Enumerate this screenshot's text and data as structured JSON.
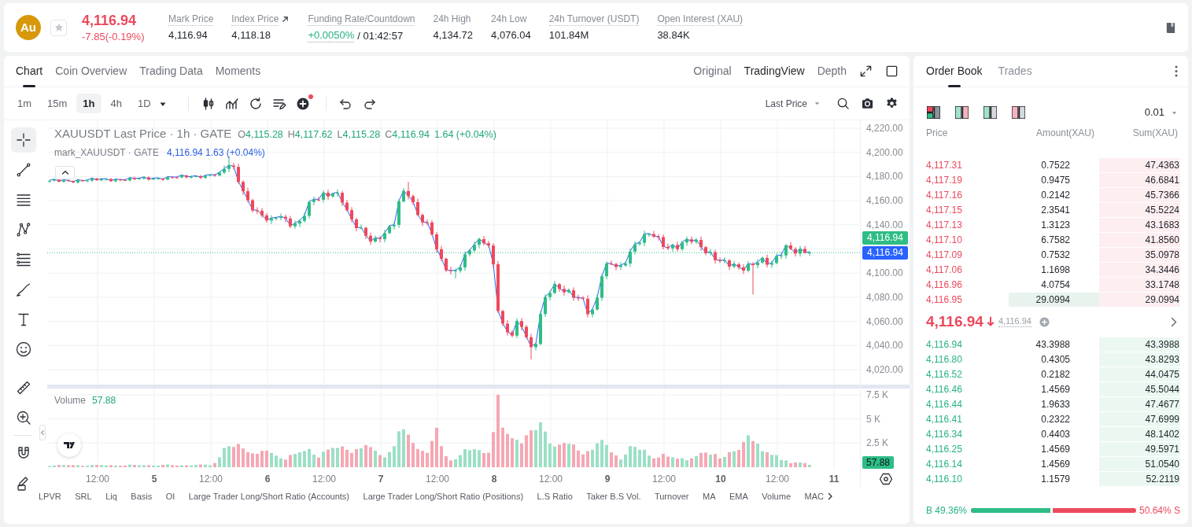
{
  "header": {
    "coin_logo": "Au",
    "starred": false,
    "last_price": "4,116.94",
    "change": "-7.85(-0.19%)",
    "stats": [
      {
        "kind": "plain",
        "label": "Mark Price",
        "value": "4,116.94",
        "underlined": true,
        "external": false
      },
      {
        "kind": "plain",
        "label": "Index Price",
        "value": "4,118.18",
        "underlined": true,
        "external": true
      },
      {
        "kind": "funding",
        "label": "Funding Rate/Countdown",
        "value": "+0.0050%",
        "countdown": "/ 01:42:57",
        "underlined": true,
        "external": false
      },
      {
        "kind": "plain",
        "label": "24h High",
        "value": "4,134.72",
        "underlined": false,
        "external": false
      },
      {
        "kind": "plain",
        "label": "24h Low",
        "value": "4,076.04",
        "underlined": false,
        "external": false
      },
      {
        "kind": "plain",
        "label": "24h Turnover (USDT)",
        "value": "101.84M",
        "underlined": true,
        "external": false
      },
      {
        "kind": "plain",
        "label": "Open Interest (XAU)",
        "value": "38.84K",
        "underlined": true,
        "external": false
      }
    ]
  },
  "chart": {
    "tabs": [
      {
        "label": "Chart",
        "selected": true
      },
      {
        "label": "Coin Overview",
        "selected": false
      },
      {
        "label": "Trading Data",
        "selected": false
      },
      {
        "label": "Moments",
        "selected": false
      }
    ],
    "view_modes": [
      {
        "label": "Original",
        "selected": false
      },
      {
        "label": "TradingView",
        "selected": true
      },
      {
        "label": "Depth",
        "selected": false
      }
    ],
    "intervals": [
      {
        "label": "1m",
        "selected": false
      },
      {
        "label": "15m",
        "selected": false
      },
      {
        "label": "1h",
        "selected": true
      },
      {
        "label": "4h",
        "selected": false
      },
      {
        "label": "1D",
        "selected": false
      }
    ],
    "price_source": "Last Price",
    "drawing_tools": [
      {
        "selected": true
      },
      {
        "selected": false
      },
      {
        "selected": false
      },
      {
        "selected": false
      },
      {
        "selected": false
      },
      {
        "selected": false
      },
      {
        "selected": false
      },
      {
        "selected": false
      },
      {
        "selected": false
      },
      {
        "selected": false
      },
      {
        "selected": false
      },
      {
        "selected": false
      }
    ],
    "legend": {
      "title": "XAUUSDT Last Price · 1h · GATE",
      "ohlc": [
        {
          "key": "O",
          "value": "4,115.28"
        },
        {
          "key": "H",
          "value": "4,117.62"
        },
        {
          "key": "L",
          "value": "4,115.28"
        },
        {
          "key": "C",
          "value": "4,116.94"
        }
      ],
      "change": "1.64 (+0.04%)"
    },
    "mark_legend": {
      "title": "mark_XAUUSDT · GATE",
      "values": "4,116.94 1.63 (+0.04%)"
    },
    "price_axis": [
      "4,220.00",
      "4,200.00",
      "4,180.00",
      "4,160.00",
      "4,140.00",
      "4,100.00",
      "4,080.00",
      "4,060.00",
      "4,040.00",
      "4,020.00"
    ],
    "price_tags": [
      {
        "text": "4,116.94",
        "color": "#2ebd85"
      },
      {
        "text": "4,116.94",
        "color": "#2962ff"
      }
    ],
    "volume": {
      "label": "Volume",
      "value": "57.88",
      "axis": [
        "7.5 K",
        "5 K",
        "2.5 K"
      ],
      "tag": "57.88"
    },
    "time_axis": [
      {
        "label": "12:00",
        "kind": "time"
      },
      {
        "label": "5",
        "kind": "day"
      },
      {
        "label": "12:00",
        "kind": "time"
      },
      {
        "label": "6",
        "kind": "day"
      },
      {
        "label": "12:00",
        "kind": "time"
      },
      {
        "label": "7",
        "kind": "day"
      },
      {
        "label": "12:00",
        "kind": "time"
      },
      {
        "label": "8",
        "kind": "day"
      },
      {
        "label": "12:00",
        "kind": "time"
      },
      {
        "label": "9",
        "kind": "day"
      },
      {
        "label": "12:00",
        "kind": "time"
      },
      {
        "label": "10",
        "kind": "day"
      },
      {
        "label": "12:00",
        "kind": "time"
      },
      {
        "label": "11",
        "kind": "day"
      }
    ],
    "indicators": [
      "LPVR",
      "SRL",
      "Liq",
      "Basis",
      "OI",
      "Large Trader Long/Short Ratio (Accounts)",
      "Large Trader Long/Short Ratio (Positions)",
      "L.S Ratio",
      "Taker B.S Vol.",
      "Turnover",
      "MA",
      "EMA",
      "Volume",
      "MAC"
    ]
  },
  "order_book": {
    "tabs": [
      {
        "label": "Order Book",
        "selected": true
      },
      {
        "label": "Trades",
        "selected": false
      }
    ],
    "layouts": [
      {
        "selected": true
      },
      {
        "selected": false
      },
      {
        "selected": false
      },
      {
        "selected": false
      }
    ],
    "precision": "0.01",
    "columns": [
      "Price",
      "Amount(XAU)",
      "Sum(XAU)"
    ],
    "asks": [
      {
        "price": "4,117.31",
        "amount": "0.7522",
        "sum": "47.4363",
        "highlighted": false
      },
      {
        "price": "4,117.19",
        "amount": "0.9475",
        "sum": "46.6841",
        "highlighted": false
      },
      {
        "price": "4,117.16",
        "amount": "0.2142",
        "sum": "45.7366",
        "highlighted": false
      },
      {
        "price": "4,117.15",
        "amount": "2.3541",
        "sum": "45.5224",
        "highlighted": false
      },
      {
        "price": "4,117.13",
        "amount": "1.3123",
        "sum": "43.1683",
        "highlighted": false
      },
      {
        "price": "4,117.10",
        "amount": "6.7582",
        "sum": "41.8560",
        "highlighted": false
      },
      {
        "price": "4,117.09",
        "amount": "0.7532",
        "sum": "35.0978",
        "highlighted": false
      },
      {
        "price": "4,117.06",
        "amount": "1.1698",
        "sum": "34.3446",
        "highlighted": false
      },
      {
        "price": "4,116.96",
        "amount": "4.0754",
        "sum": "33.1748",
        "highlighted": false
      },
      {
        "price": "4,116.95",
        "amount": "29.0994",
        "sum": "29.0994",
        "highlighted": true
      }
    ],
    "last_price": "4,116.94",
    "price_falling": true,
    "mark_price": "4,116.94",
    "bids": [
      {
        "price": "4,116.94",
        "amount": "43.3988",
        "sum": "43.3988",
        "highlighted": false
      },
      {
        "price": "4,116.80",
        "amount": "0.4305",
        "sum": "43.8293",
        "highlighted": false
      },
      {
        "price": "4,116.52",
        "amount": "0.2182",
        "sum": "44.0475",
        "highlighted": false
      },
      {
        "price": "4,116.46",
        "amount": "1.4569",
        "sum": "45.5044",
        "highlighted": false
      },
      {
        "price": "4,116.44",
        "amount": "1.9633",
        "sum": "47.4677",
        "highlighted": false
      },
      {
        "price": "4,116.41",
        "amount": "0.2322",
        "sum": "47.6999",
        "highlighted": false
      },
      {
        "price": "4,116.34",
        "amount": "0.4403",
        "sum": "48.1402",
        "highlighted": false
      },
      {
        "price": "4,116.25",
        "amount": "1.4569",
        "sum": "49.5971",
        "highlighted": false
      },
      {
        "price": "4,116.14",
        "amount": "1.4569",
        "sum": "51.0540",
        "highlighted": false
      },
      {
        "price": "4,116.10",
        "amount": "1.1579",
        "sum": "52.2119",
        "highlighted": false
      }
    ],
    "ratio": {
      "buy": "B 49.36%",
      "sell": "50.64% S",
      "level": 0.4936
    }
  }
}
